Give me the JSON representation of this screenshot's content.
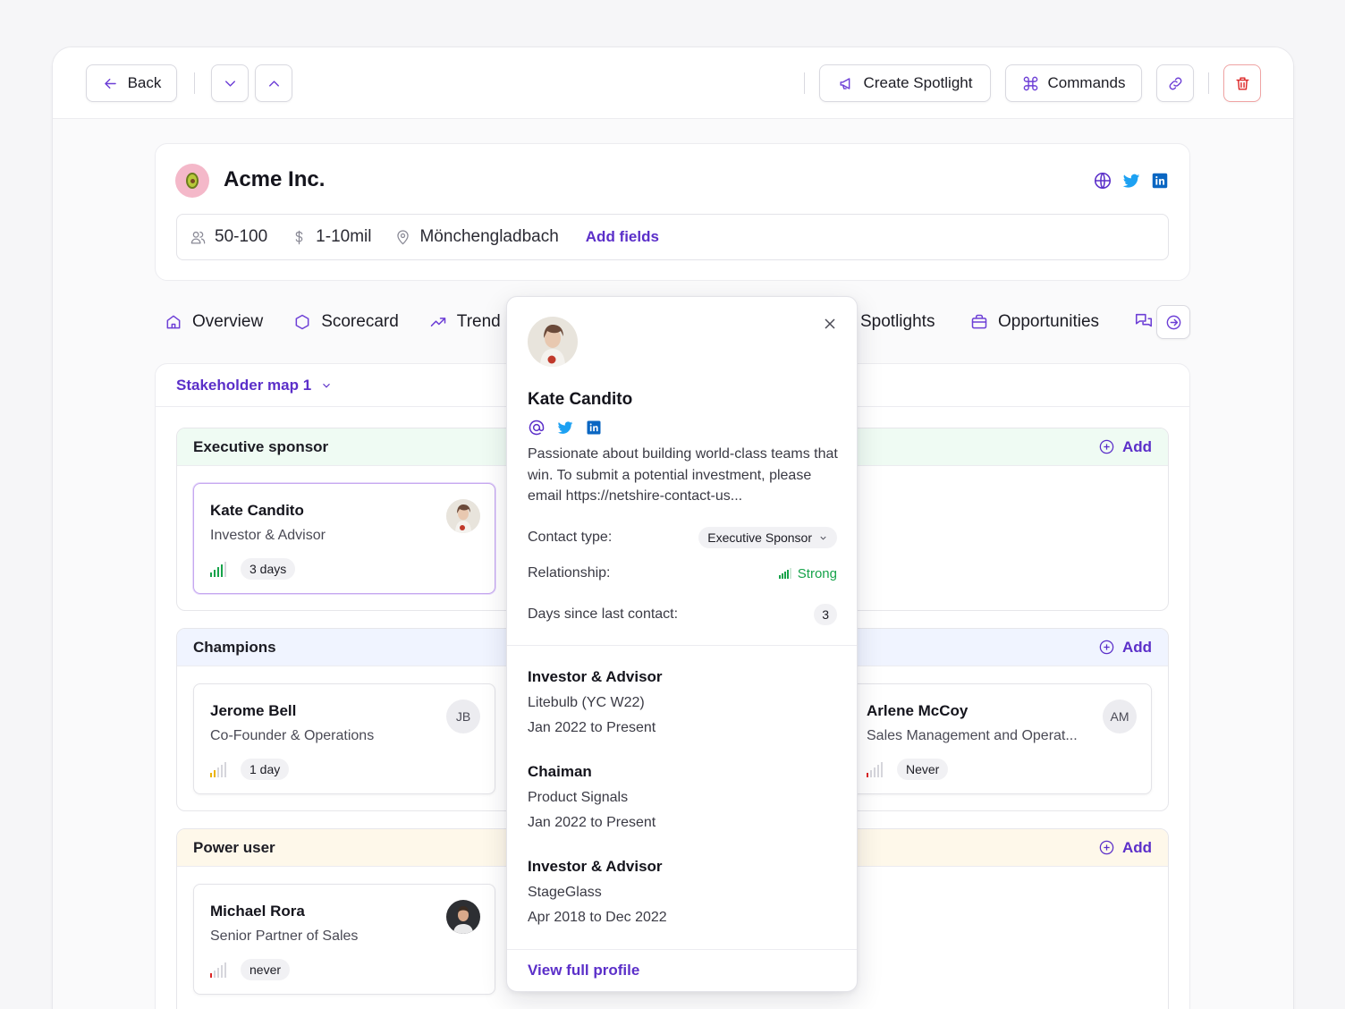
{
  "toolbar": {
    "back_label": "Back",
    "create_spotlight_label": "Create Spotlight",
    "commands_label": "Commands"
  },
  "company": {
    "name": "Acme Inc.",
    "employees": "50-100",
    "revenue": "1-10mil",
    "location": "Mönchengladbach",
    "add_fields_label": "Add fields"
  },
  "tabs": [
    {
      "label": "Overview",
      "icon": "home-icon"
    },
    {
      "label": "Scorecard",
      "icon": "hexagon-icon"
    },
    {
      "label": "Trend",
      "icon": "trend-icon"
    },
    {
      "label": "Spotlights",
      "icon": ""
    },
    {
      "label": "Opportunities",
      "icon": "briefcase-icon"
    }
  ],
  "map": {
    "selector_label": "Stakeholder map 1",
    "add_label": "Add",
    "groups": [
      {
        "title": "Executive sponsor",
        "color": "#effbf3"
      },
      {
        "title": "Champions",
        "color": "#f0f4ff"
      },
      {
        "title": "Power user",
        "color": "#fef8ea"
      }
    ]
  },
  "people": {
    "kate": {
      "name": "Kate Candito",
      "role": "Investor & Advisor",
      "last_contact": "3 days",
      "strength": 4
    },
    "jerome": {
      "name": "Jerome Bell",
      "role": "Co-Founder & Operations",
      "last_contact": "1 day",
      "strength": 2,
      "initials": "JB"
    },
    "arlene": {
      "name": "Arlene McCoy",
      "role": "Sales Management and Operat...",
      "last_contact": "Never",
      "strength": 1,
      "initials": "AM"
    },
    "michael": {
      "name": "Michael Rora",
      "role": "Senior Partner of Sales",
      "last_contact": "never",
      "strength": 1
    }
  },
  "popover": {
    "name": "Kate Candito",
    "bio": "Passionate about building world-class teams that win. To submit a potential investment, please email https://netshire-contact-us...",
    "contact_type_label": "Contact type:",
    "contact_type_value": "Executive Sponsor",
    "relationship_label": "Relationship:",
    "relationship_value": "Strong",
    "days_label": "Days since last contact:",
    "days_value": "3",
    "experience": [
      {
        "title": "Investor & Advisor",
        "company": "Litebulb (YC W22)",
        "dates": "Jan 2022 to Present"
      },
      {
        "title": "Chaiman",
        "company": "Product Signals",
        "dates": "Jan 2022 to Present"
      },
      {
        "title": "Investor & Advisor",
        "company": "StageGlass",
        "dates": "Apr 2018 to Dec 2022"
      }
    ],
    "view_profile_label": "View full profile"
  },
  "colors": {
    "accent": "#5b2fc9",
    "strong": "#16a34a",
    "medium": "#eab308",
    "weak": "#dc2626",
    "twitter": "#1da1f2",
    "linkedin": "#0a66c2"
  }
}
